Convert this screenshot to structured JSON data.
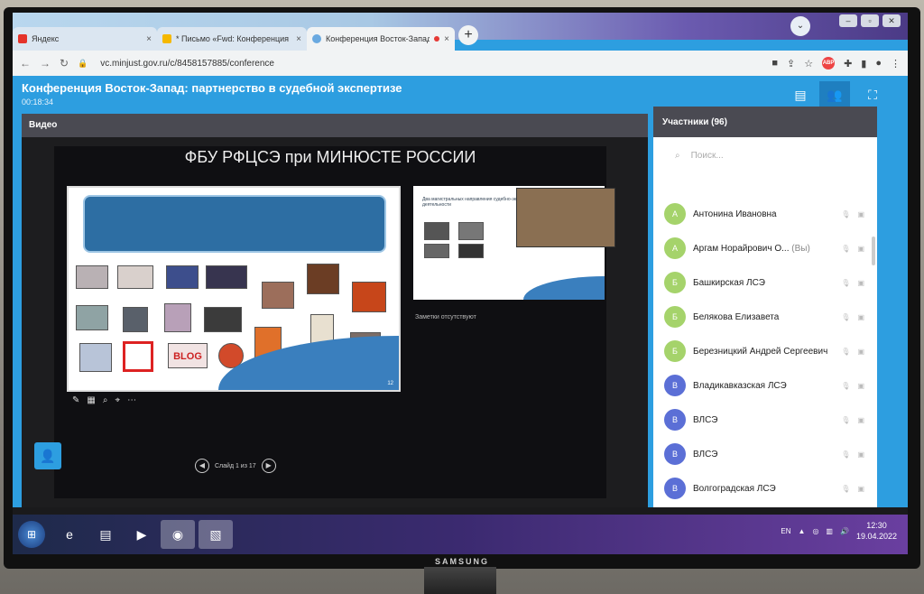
{
  "browser": {
    "tabs": [
      {
        "label": "Яндекс",
        "favicon_color": "#e5332a",
        "active": false
      },
      {
        "label": "* Письмо «Fwd: Конференция В",
        "favicon_color": "#f5b800",
        "active": false
      },
      {
        "label": "Конференция Восток-Запад",
        "favicon_color": "#6aa9e0",
        "active": true
      }
    ],
    "url": "vc.minjust.gov.ru/c/8458157885/conference",
    "close_glyph": "×",
    "newtab_glyph": "+"
  },
  "conference": {
    "title": "Конференция Восток-Запад: партнерство в судебной экспертизе",
    "elapsed": "00:18:34"
  },
  "video": {
    "label": "Видео",
    "shared_title": "ФБУ РФЦСЭ при МИНЮСТЕ РОССИИ",
    "slide_side_title": "Два магистральных направления судебно-экспертной деятельности",
    "notes": "Заметки отсутствуют",
    "pager": "Слайд 1 из 17",
    "slide_number": "12"
  },
  "participants": {
    "header": "Участники (96)",
    "search_placeholder": "Поиск...",
    "list": [
      {
        "initial": "А",
        "name": "Антонина Ивановна",
        "you": "",
        "color": "#a5d36b"
      },
      {
        "initial": "А",
        "name": "Аргам Норайрович О...",
        "you": "(Вы)",
        "color": "#a5d36b"
      },
      {
        "initial": "Б",
        "name": "Башкирская ЛСЭ",
        "you": "",
        "color": "#a5d36b"
      },
      {
        "initial": "Б",
        "name": "Белякова Елизавета",
        "you": "",
        "color": "#a5d36b"
      },
      {
        "initial": "Б",
        "name": "Березницкий Андрей Сергеевич",
        "you": "",
        "color": "#a5d36b"
      },
      {
        "initial": "В",
        "name": "Владикавказская ЛСЭ",
        "you": "",
        "color": "#5b6fd6"
      },
      {
        "initial": "В",
        "name": "ВЛСЭ",
        "you": "",
        "color": "#5b6fd6"
      },
      {
        "initial": "В",
        "name": "ВЛСЭ",
        "you": "",
        "color": "#5b6fd6"
      },
      {
        "initial": "В",
        "name": "Волгоградская ЛСЭ",
        "you": "",
        "color": "#5b6fd6"
      }
    ]
  },
  "taskbar": {
    "lang": "EN",
    "time": "12:30",
    "date": "19.04.2022"
  },
  "monitor": {
    "brand": "SAMSUNG"
  }
}
